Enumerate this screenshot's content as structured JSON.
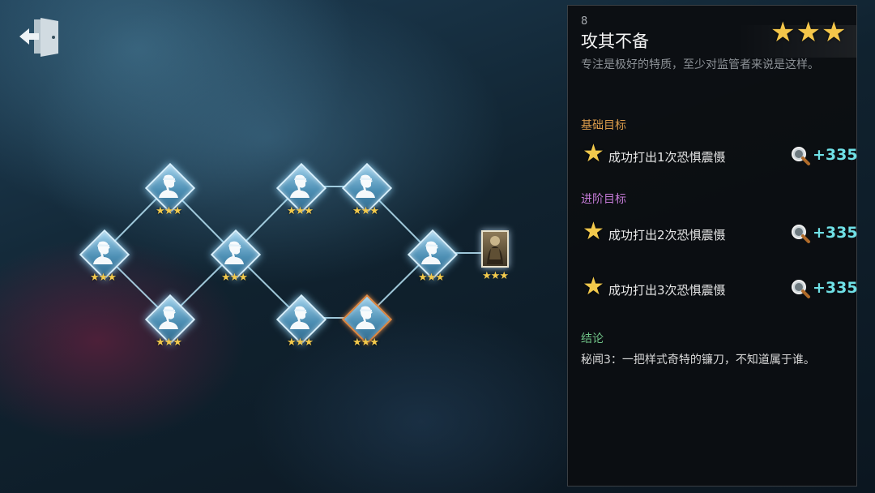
{
  "exit_icon": "exit-door-icon",
  "map": {
    "nodes": [
      {
        "id": "n1",
        "icon": "detective-bust-icon",
        "stars": "★★★"
      },
      {
        "id": "n2",
        "icon": "detective-bust-icon",
        "stars": "★★★"
      },
      {
        "id": "n3",
        "icon": "detective-bust-icon",
        "stars": "★★★"
      },
      {
        "id": "n4",
        "icon": "detective-bust-icon",
        "stars": "★★★"
      },
      {
        "id": "n5",
        "icon": "detective-bust-icon",
        "stars": "★★★"
      },
      {
        "id": "n6",
        "icon": "detective-bust-icon",
        "stars": "★★★"
      },
      {
        "id": "n7",
        "icon": "detective-bust-icon",
        "stars": "★★★"
      },
      {
        "id": "n8",
        "icon": "detective-bust-icon",
        "stars": "★★★",
        "selected": true
      },
      {
        "id": "n9",
        "icon": "detective-bust-icon",
        "stars": "★★★"
      }
    ],
    "final_card": {
      "icon": "character-portrait-card",
      "stars": "★★★"
    }
  },
  "panel": {
    "number": "8",
    "title": "攻其不备",
    "rating_stars": "★★★",
    "subtitle": "专注是极好的特质，至少对监管者来说是这样。",
    "basic_heading": "基础目标",
    "advanced_heading": "进阶目标",
    "conclusion_heading": "结论",
    "goals": [
      {
        "text": "成功打出1次恐惧震慑",
        "points": "+335",
        "icon": "magnifier-icon"
      },
      {
        "text": "成功打出2次恐惧震慑",
        "points": "+335",
        "icon": "magnifier-icon"
      },
      {
        "text": "成功打出3次恐惧震慑",
        "points": "+335",
        "icon": "magnifier-icon"
      }
    ],
    "conclusion": "秘闻3：一把样式奇特的镰刀，不知道属于谁。"
  },
  "colors": {
    "accent_gold": "#f2c94c",
    "basic_heading": "#d99a4a",
    "advanced_heading": "#c47ad6",
    "conclusion_heading": "#70c287",
    "points": "#6fe0e6",
    "node_selected_border": "#e08a44"
  }
}
